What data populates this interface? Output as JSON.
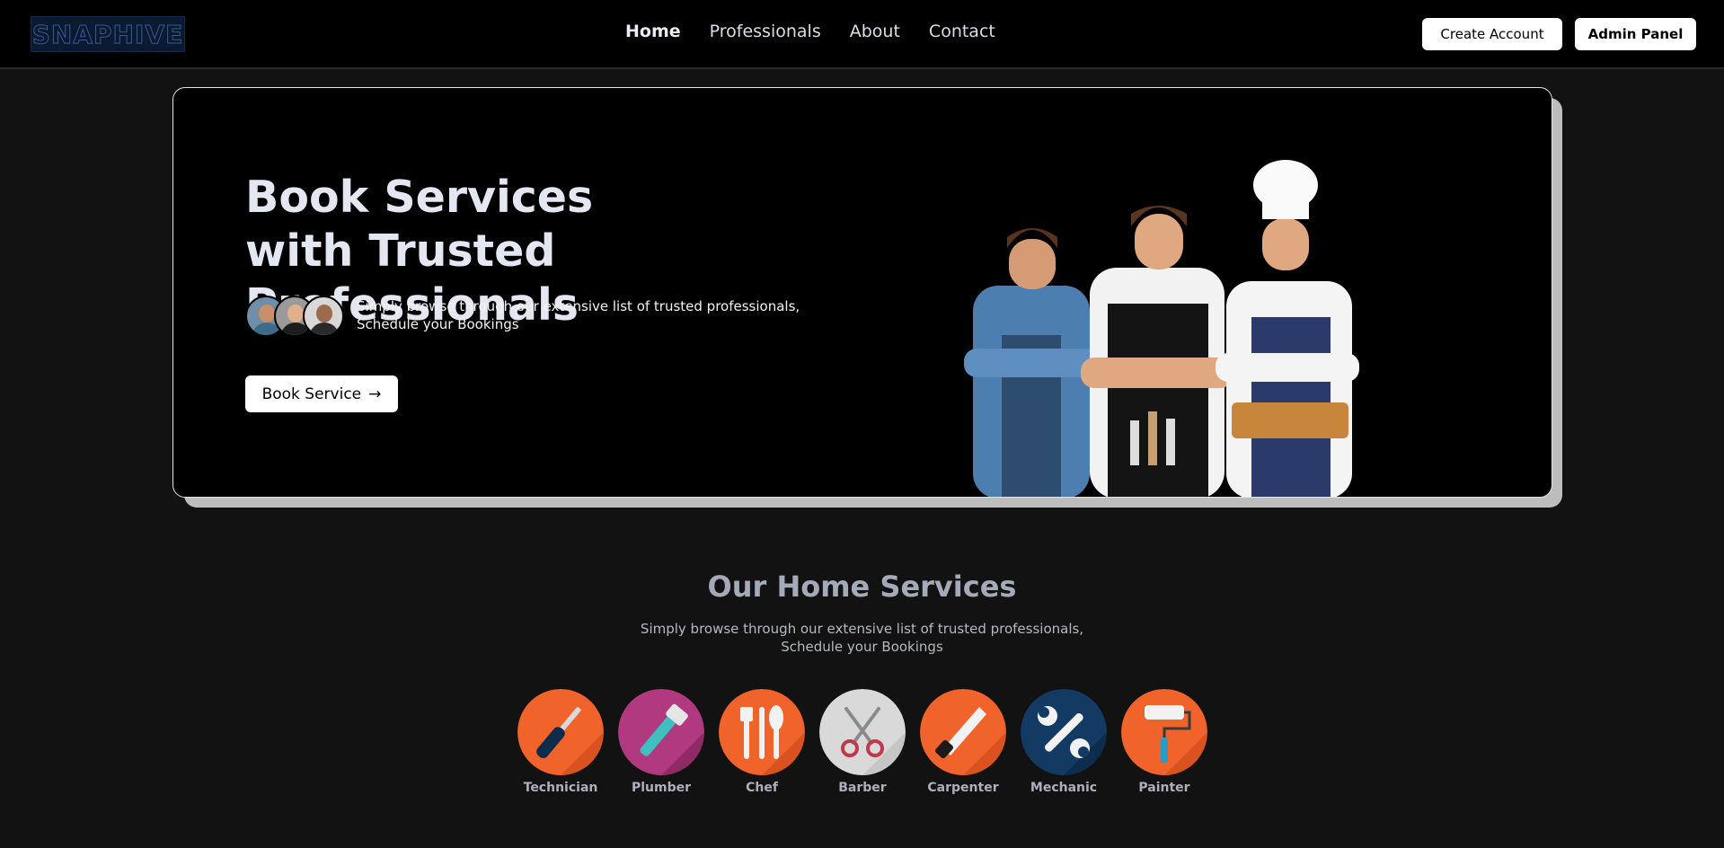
{
  "brand": {
    "logo_text": "SNAPHIVE"
  },
  "nav": {
    "links": [
      {
        "label": "Home",
        "active": true
      },
      {
        "label": "Professionals"
      },
      {
        "label": "About"
      },
      {
        "label": "Contact"
      }
    ],
    "create_account_label": "Create Account",
    "admin_panel_label": "Admin Panel"
  },
  "hero": {
    "title_line1": "Book Services",
    "title_line2": "with Trusted Professionals",
    "subtitle_line1": "Simply browse through our extensive list of trusted professionals,",
    "subtitle_line2": "Schedule your Bookings",
    "cta_label": "Book Service",
    "cta_arrow": "→"
  },
  "services_section": {
    "title": "Our Home Services",
    "subtitle_line1": "Simply browse through our extensive list of trusted professionals,",
    "subtitle_line2": "Schedule your Bookings",
    "items": [
      {
        "label": "Technician",
        "icon": "screwdriver-icon",
        "color": "#f0632a"
      },
      {
        "label": "Plumber",
        "icon": "pipe-wrench-icon",
        "color": "#b0397f"
      },
      {
        "label": "Chef",
        "icon": "cutlery-icon",
        "color": "#f0632a"
      },
      {
        "label": "Barber",
        "icon": "scissors-icon",
        "color": "#d9d9d9"
      },
      {
        "label": "Carpenter",
        "icon": "saw-icon",
        "color": "#f0632a"
      },
      {
        "label": "Mechanic",
        "icon": "wrench-icon",
        "color": "#123a63"
      },
      {
        "label": "Painter",
        "icon": "paint-roller-icon",
        "color": "#f0632a"
      }
    ]
  },
  "colors": {
    "page_bg": "#121212",
    "navbar_bg": "#000000",
    "hero_bg": "#000000",
    "hero_shadow": "#bdbdbd",
    "accent_orange": "#f0632a"
  }
}
